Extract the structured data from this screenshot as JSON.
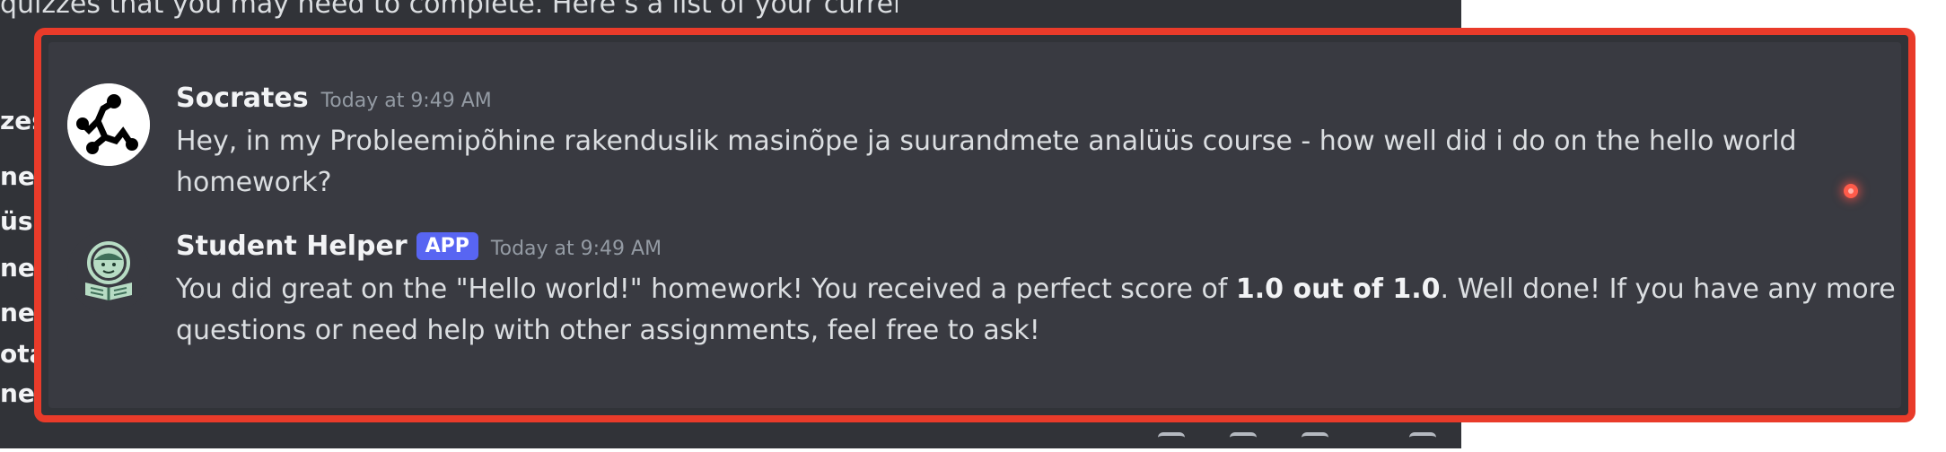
{
  "background": {
    "partial_line": "quizzes that you may need to complete. Here’s a list of your current tasks:",
    "left_fragments": [
      "zes",
      "nes",
      "üsi",
      "nes",
      "nes",
      "ota",
      "nes"
    ]
  },
  "messages": [
    {
      "author": "Socrates",
      "timestamp": "Today at 9:49 AM",
      "text": "Hey, in my Probleemipõhine rakenduslik masinõpe ja suurandmete analüüs course - how well did i do on the hello world homework?"
    },
    {
      "author": "Student Helper",
      "tag": "APP",
      "timestamp": "Today at 9:49 AM",
      "text_before": "You did great on the \"Hello world!\" homework! You received a perfect score of ",
      "text_bold": "1.0 out of 1.0",
      "text_after": ". Well done! If you have any more questions or need help with other assignments, feel free to ask!"
    }
  ],
  "colors": {
    "frame_border": "#e93b2a",
    "app_tag": "#5865f2",
    "helper_avatar": "#3f6f59"
  },
  "icons": {
    "socrates_avatar": "network-nodes-icon",
    "helper_avatar": "student-reading-icon"
  }
}
